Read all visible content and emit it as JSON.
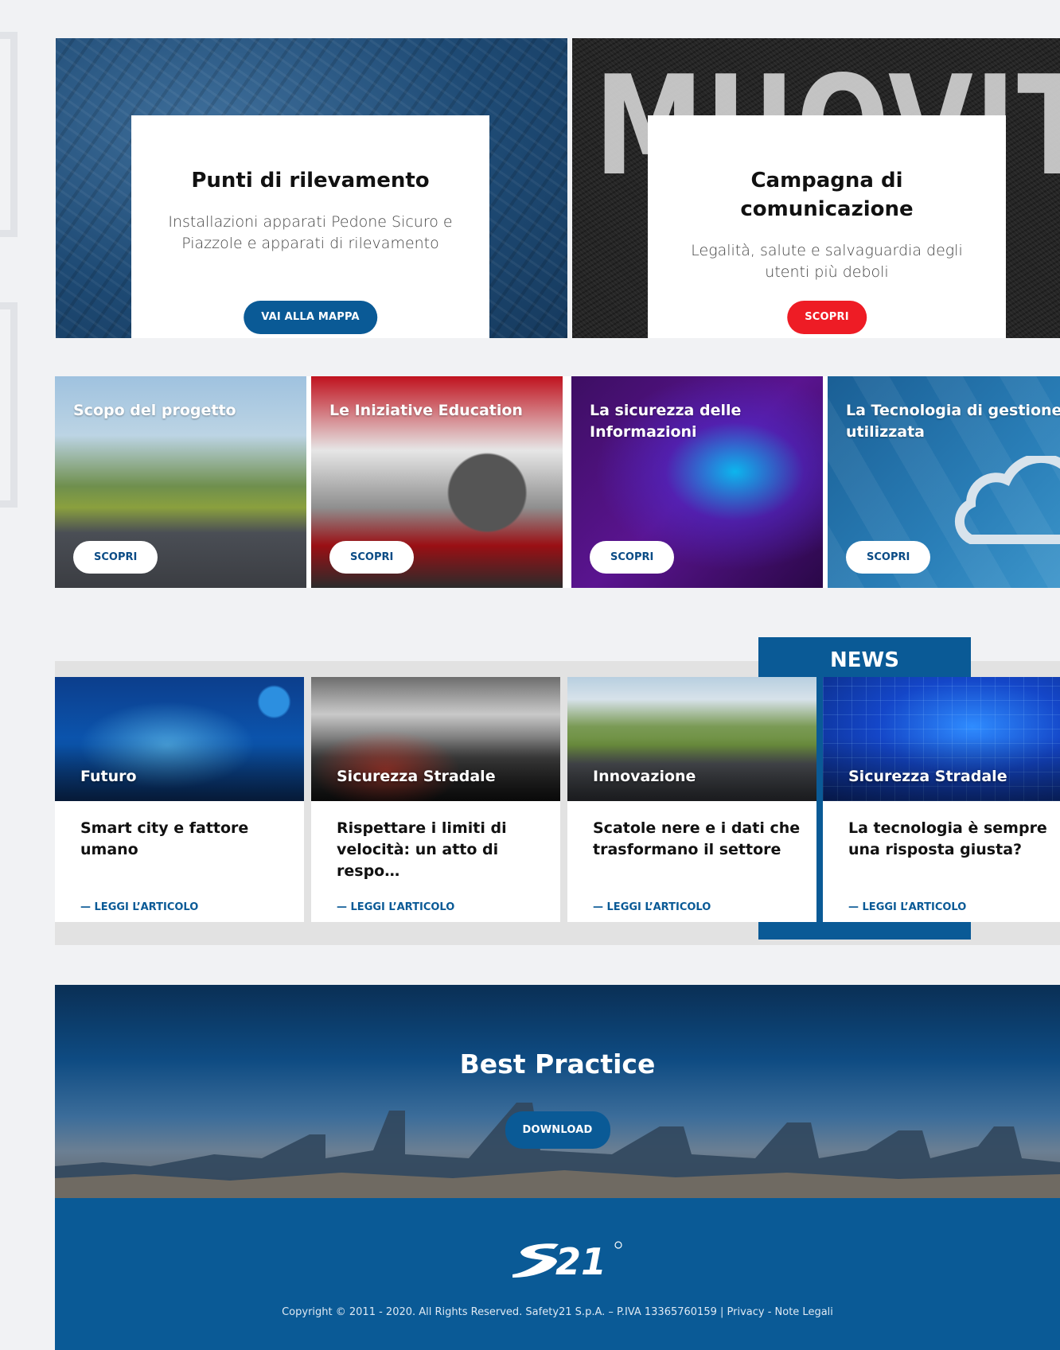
{
  "hero": [
    {
      "title": "Punti di rilevamento",
      "text": "Installazioni apparati Pedone Sicuro e Piazzole e apparati di rilevamento",
      "button": "VAI ALLA MAPPA"
    },
    {
      "title": "Campagna di comunicazione",
      "text": "Legalità, salute e salvaguardia degli utenti più deboli",
      "button": "SCOPRI",
      "background_text": "MUOVITI"
    }
  ],
  "tiles": [
    {
      "title": "Scopo del progetto",
      "button": "SCOPRI"
    },
    {
      "title": "Le Iniziative Education",
      "button": "SCOPRI"
    },
    {
      "title": "La sicurezza delle Informazioni",
      "button": "SCOPRI"
    },
    {
      "title": "La Tecnologia di gestione utilizzata",
      "button": "SCOPRI"
    }
  ],
  "news": {
    "label": "NEWS",
    "articles": [
      {
        "category": "Futuro",
        "title": "Smart city e fattore umano",
        "link": "— LEGGI L’ARTICOLO"
      },
      {
        "category": "Sicurezza Stradale",
        "title": "Rispettare i limiti di velocità: un atto di respo…",
        "link": "— LEGGI L’ARTICOLO"
      },
      {
        "category": "Innovazione",
        "title": "Scatole nere e i dati che trasformano il settore",
        "link": "— LEGGI L’ARTICOLO"
      },
      {
        "category": "Sicurezza Stradale",
        "title": "La tecnologia è sempre una risposta giusta?",
        "link": "— LEGGI L’ARTICOLO"
      }
    ]
  },
  "best_practice": {
    "title": "Best Practice",
    "button": "DOWNLOAD"
  },
  "footer": {
    "logo_text": "S21",
    "copyright": "Copyright © 2011 - 2020. All Rights Reserved. Safety21 S.p.A. – P.IVA 13365760159 | Privacy - Note Legali"
  },
  "colors": {
    "brand_blue": "#0a5a96",
    "accent_red": "#ee1c25",
    "page_background": "#f1f2f4"
  }
}
